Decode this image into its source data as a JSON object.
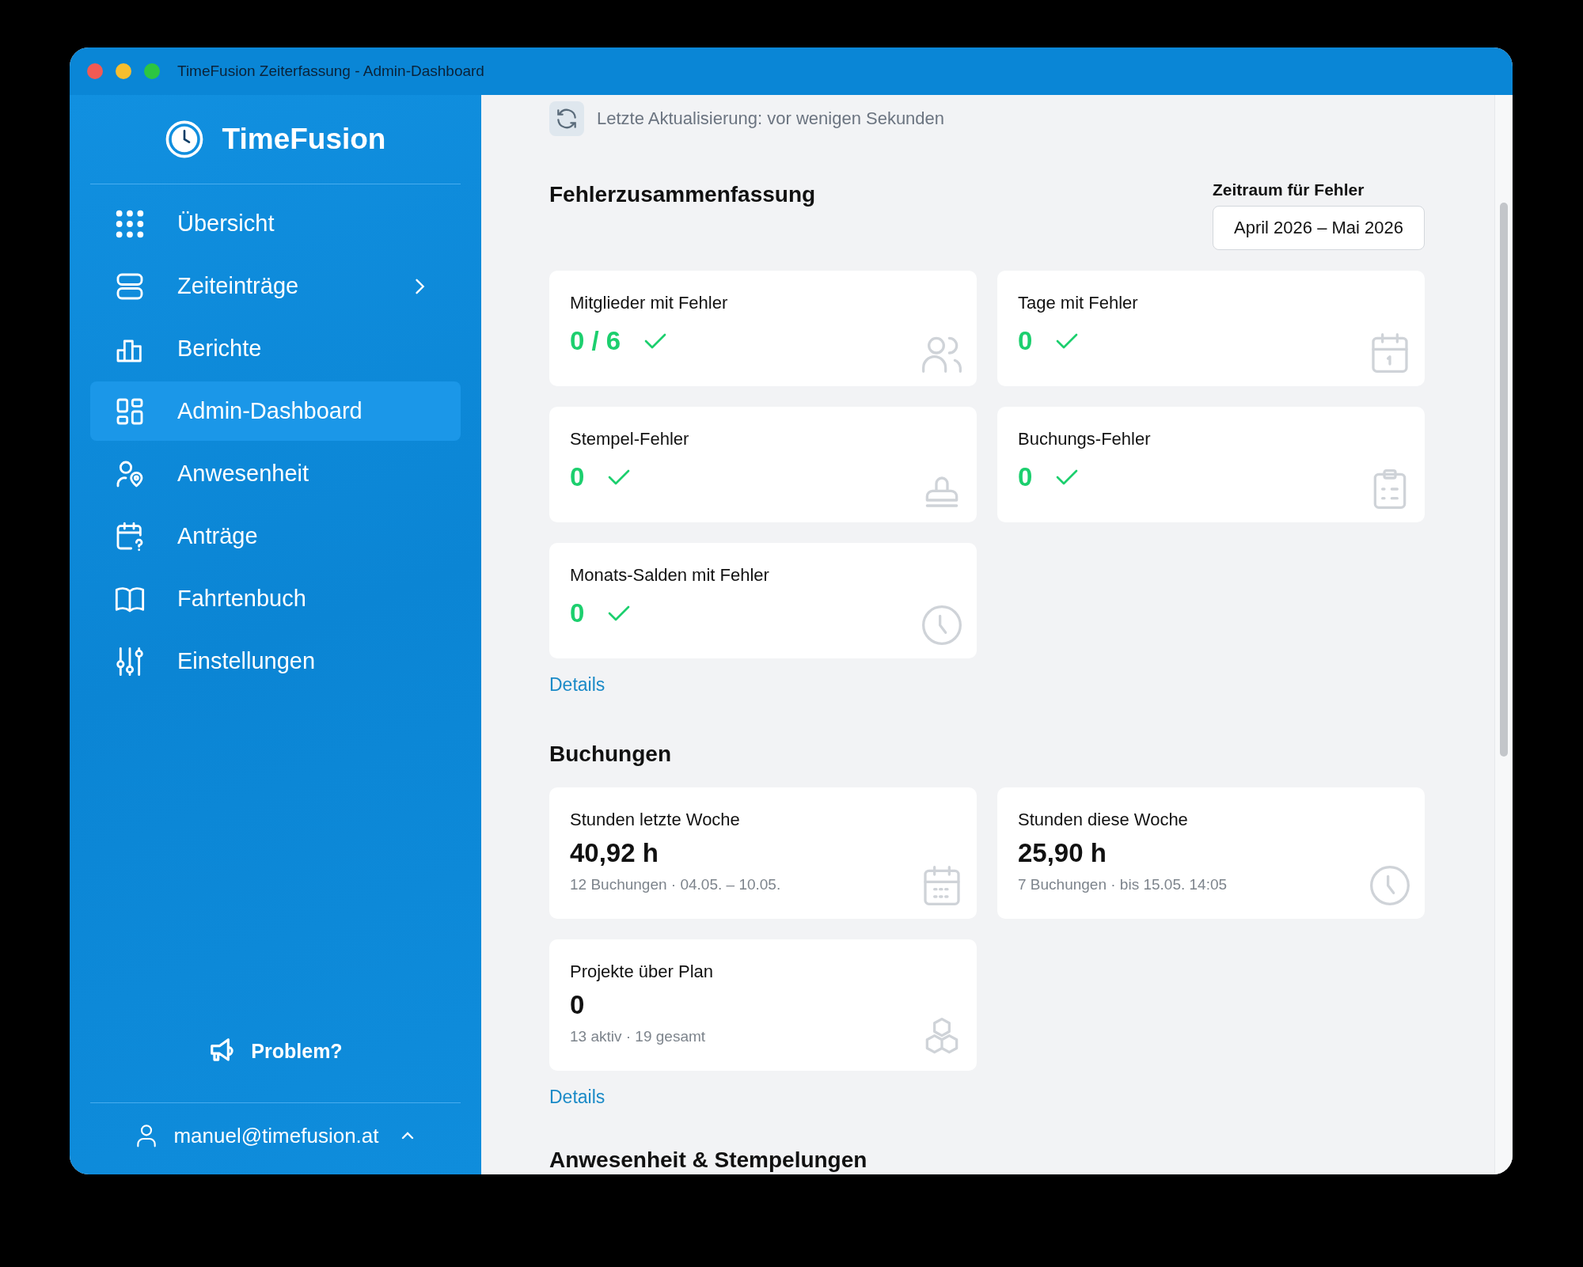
{
  "window": {
    "title": "TimeFusion Zeiterfassung - Admin-Dashboard"
  },
  "sidebar": {
    "brand": "TimeFusion",
    "items": [
      {
        "label": "Übersicht",
        "selected": false,
        "submenu": false
      },
      {
        "label": "Zeiteinträge",
        "selected": false,
        "submenu": true
      },
      {
        "label": "Berichte",
        "selected": false,
        "submenu": false
      },
      {
        "label": "Admin-Dashboard",
        "selected": true,
        "submenu": false
      },
      {
        "label": "Anwesenheit",
        "selected": false,
        "submenu": false
      },
      {
        "label": "Anträge",
        "selected": false,
        "submenu": false
      },
      {
        "label": "Fahrtenbuch",
        "selected": false,
        "submenu": false
      },
      {
        "label": "Einstellungen",
        "selected": false,
        "submenu": false
      }
    ],
    "problem_button": "Problem?",
    "user": "manuel@timefusion.at"
  },
  "refresh_status": "Letzte Aktualisierung: vor wenigen Sekunden",
  "error_summary": {
    "title": "Fehlerzusammenfassung",
    "period_label": "Zeitraum für Fehler",
    "period_value": "April 2026 – Mai 2026",
    "cards": [
      {
        "title": "Mitglieder mit Fehler",
        "value": "0 / 6",
        "ok": true
      },
      {
        "title": "Tage mit Fehler",
        "value": "0",
        "ok": true
      },
      {
        "title": "Stempel-Fehler",
        "value": "0",
        "ok": true
      },
      {
        "title": "Buchungs-Fehler",
        "value": "0",
        "ok": true
      },
      {
        "title": "Monats-Salden mit Fehler",
        "value": "0",
        "ok": true
      }
    ],
    "details_link": "Details"
  },
  "bookings": {
    "title": "Buchungen",
    "cards": [
      {
        "title": "Stunden letzte Woche",
        "value": "40,92 h",
        "subtitle": "12 Buchungen · 04.05. – 10.05."
      },
      {
        "title": "Stunden diese Woche",
        "value": "25,90 h",
        "subtitle": "7 Buchungen · bis 15.05. 14:05"
      },
      {
        "title": "Projekte über Plan",
        "value": "0",
        "subtitle": "13 aktiv · 19 gesamt"
      }
    ],
    "details_link": "Details"
  },
  "attendance": {
    "title": "Anwesenheit & Stempelungen"
  }
}
